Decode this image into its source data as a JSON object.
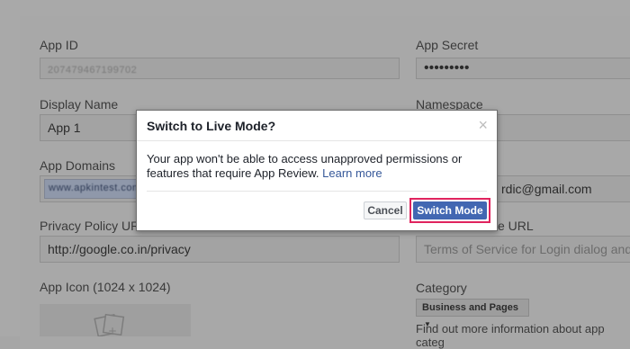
{
  "form": {
    "app_id_label": "App ID",
    "app_id_value": "207479467199702",
    "app_secret_label": "App Secret",
    "app_secret_value": "•••••••••",
    "display_name_label": "Display Name",
    "display_name_value": "App 1",
    "namespace_label": "Namespace",
    "app_domains_label": "App Domains",
    "app_domains_chip": "www.apkintest.com",
    "contact_email_value": "rdic@gmail.com",
    "privacy_policy_label": "Privacy Policy URL",
    "privacy_policy_value": "http://google.co.in/privacy",
    "terms_url_label": "e URL",
    "terms_url_placeholder": "Terms of Service for Login dialog and App",
    "app_icon_label": "App Icon (1024 x 1024)",
    "category_label": "Category",
    "category_value": "Business and Pages",
    "category_help": "Find out more information about app categ"
  },
  "modal": {
    "title": "Switch to Live Mode?",
    "close": "×",
    "body_text": "Your app won't be able to access unapproved permissions or features that require App Review.",
    "learn_more": "Learn more",
    "cancel_label": "Cancel",
    "switch_label": "Switch Mode"
  }
}
